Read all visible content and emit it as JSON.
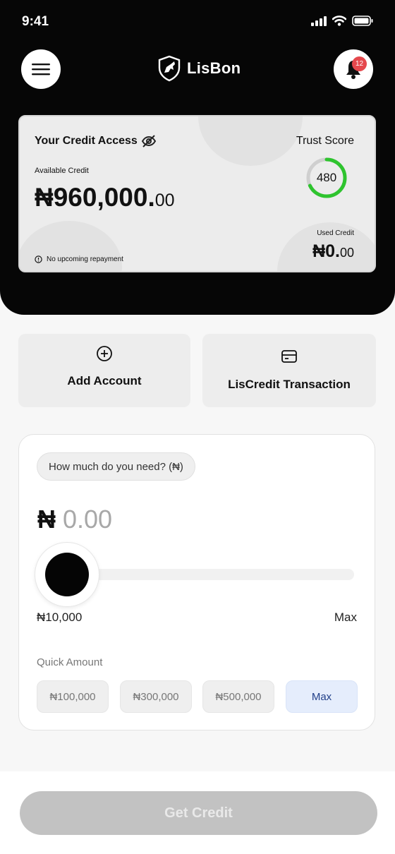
{
  "status_bar": {
    "time": "9:41"
  },
  "header": {
    "brand_name": "LisBon",
    "notification_count": "12"
  },
  "credit_card": {
    "title": "Your Credit Access",
    "available_label": "Available Credit",
    "available_main": "₦960,000.",
    "available_decimal": "00",
    "trust_label": "Trust Score",
    "trust_score": "480",
    "used_label": "Used Credit",
    "used_main": "₦0.",
    "used_decimal": "00",
    "repayment_note": "No upcoming repayment",
    "colors": {
      "gauge_green": "#2ec42e",
      "gauge_track": "#cfcfcf"
    }
  },
  "actions": {
    "add_account": "Add Account",
    "transaction": "LisCredit Transaction"
  },
  "loan": {
    "question": "How much do you need? (₦)",
    "currency_symbol": "₦",
    "amount": "0.00",
    "slider_min": "₦10,000",
    "slider_max": "Max",
    "quick_label": "Quick Amount",
    "quick_amounts": [
      "₦100,000",
      "₦300,000",
      "₦500,000",
      "Max"
    ]
  },
  "cta": {
    "label": "Get Credit"
  }
}
